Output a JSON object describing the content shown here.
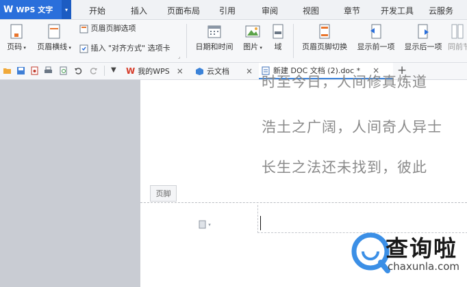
{
  "titlebar": {
    "app_logo": "W",
    "app_title": "WPS 文字",
    "dropdown": "▾",
    "tabs": [
      "开始",
      "插入",
      "页面布局",
      "引用",
      "审阅",
      "视图",
      "章节",
      "开发工具",
      "云服务"
    ]
  },
  "ribbon": {
    "page_number": "页码",
    "header_line": "页眉横线",
    "header_footer_options": "页眉页脚选项",
    "insert_alignment_tab": "插入 \"对齐方式\" 选项卡",
    "date_time": "日期和时间",
    "picture": "图片",
    "field": "域",
    "header_footer_switch": "页眉页脚切换",
    "show_previous": "显示前一项",
    "show_next": "显示后一项",
    "same_as_previous": "同前节"
  },
  "doc_tabs": [
    {
      "label": "我的WPS",
      "close": "×"
    },
    {
      "label": "云文档",
      "close": "×"
    },
    {
      "label": "新建 DOC 文档 (2).doc *",
      "close": "×"
    }
  ],
  "add_tab": "+",
  "document": {
    "lines": [
      "时至今日，人间修真炼道",
      "浩土之广阔，人间奇人异士",
      "长生之法还未找到，彼此"
    ],
    "footer_label": "页脚"
  },
  "watermark": {
    "brand": "查询啦",
    "url": "chaxunla.com"
  },
  "colors": {
    "accent": "#2a6fdb",
    "watermark_blue": "#3b8fe6",
    "text_grey": "#8a8a8a"
  }
}
